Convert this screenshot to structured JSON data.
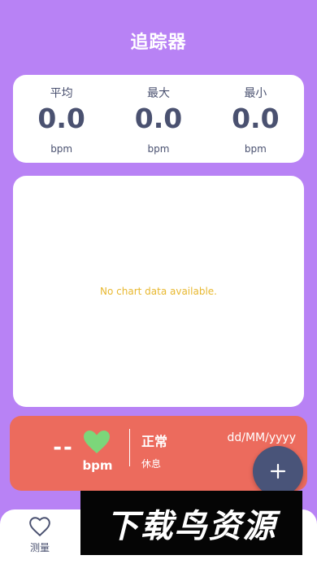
{
  "header": {
    "title": "追踪器"
  },
  "stats": [
    {
      "label": "平均",
      "value": "0.0",
      "unit": "bpm"
    },
    {
      "label": "最大",
      "value": "0.0",
      "unit": "bpm"
    },
    {
      "label": "最小",
      "value": "0.0",
      "unit": "bpm"
    }
  ],
  "chart": {
    "empty_message": "No chart data available."
  },
  "measurement": {
    "value": "--",
    "unit": "bpm",
    "status": "正常",
    "state": "休息",
    "date": "dd/MM/yyyy"
  },
  "fab": {
    "icon": "plus-icon"
  },
  "bottom_nav": {
    "items": [
      {
        "label": "测量",
        "icon": "heart-outline-icon"
      }
    ]
  },
  "watermark": {
    "text": "下载鸟资源"
  },
  "colors": {
    "background": "#b882f5",
    "card": "#ffffff",
    "accent_red": "#ec6b5d",
    "heart_green": "#7cd67a",
    "fab": "#495479",
    "empty_text": "#e8b830"
  }
}
